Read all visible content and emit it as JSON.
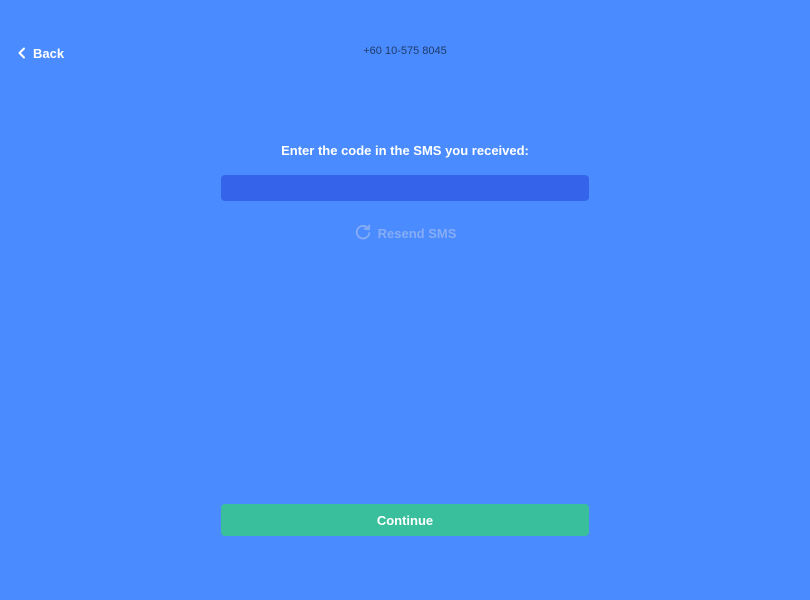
{
  "header": {
    "back_label": "Back",
    "phone_number": "+60 10-575 8045"
  },
  "verify": {
    "prompt": "Enter the code in the SMS you received:",
    "code_value": "",
    "resend_label": "Resend SMS"
  },
  "actions": {
    "continue_label": "Continue"
  },
  "icons": {
    "back": "chevron-left-icon",
    "resend": "refresh-icon"
  },
  "colors": {
    "background": "#4a8cff",
    "input_bg": "#3563e9",
    "continue_bg": "#39bf9c",
    "resend_disabled": "#86acf6"
  }
}
